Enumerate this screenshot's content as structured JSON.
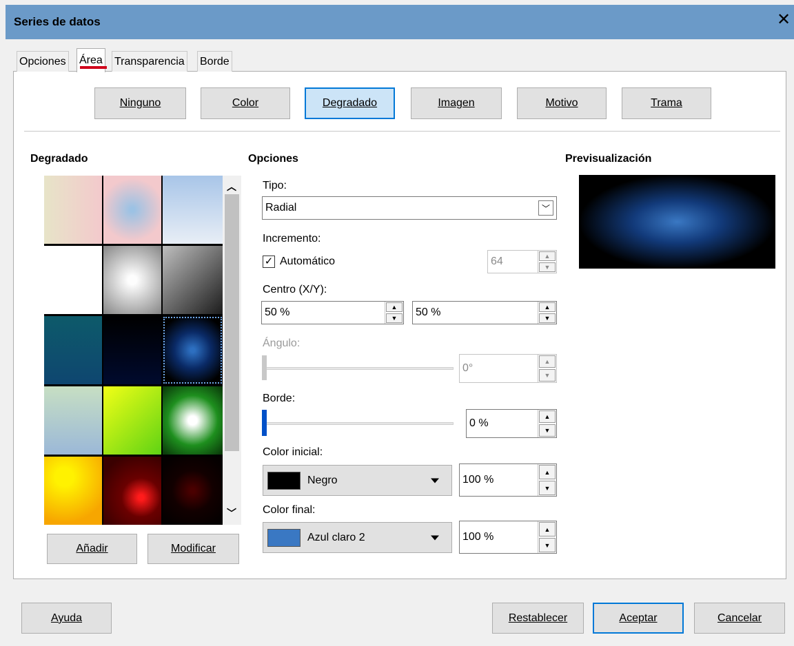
{
  "window": {
    "title": "Series de datos"
  },
  "tabs": [
    "Opciones",
    "Área",
    "Transparencia",
    "Borde"
  ],
  "area_buttons": [
    "Ninguno",
    "Color",
    "Degradado",
    "Imagen",
    "Motivo",
    "Trama"
  ],
  "gradient_panel": {
    "heading": "Degradado",
    "add_label": "Añadir",
    "modify_label": "Modificar"
  },
  "options": {
    "heading": "Opciones",
    "tipo_label": "Tipo:",
    "tipo_value": "Radial",
    "incremento_label": "Incremento:",
    "automatico_label": "Automático",
    "automatico_checked": true,
    "incremento_value": "64",
    "centro_label": "Centro (X/Y):",
    "centro_x": "50 %",
    "centro_y": "50 %",
    "angulo_label": "Ángulo:",
    "angulo_value": "0°",
    "borde_label": "Borde:",
    "borde_value": "0 %",
    "borde_level": 0,
    "color_inicial_label": "Color inicial:",
    "color_inicial_name": "Negro",
    "color_inicial_hex": "#000000",
    "color_inicial_pct": "100 %",
    "color_final_label": "Color final:",
    "color_final_name": "Azul claro 2",
    "color_final_hex": "#3a78c3",
    "color_final_pct": "100 %"
  },
  "preview": {
    "heading": "Previsualización"
  },
  "footer": {
    "help": "Ayuda",
    "reset": "Restablecer",
    "ok": "Aceptar",
    "cancel": "Cancelar"
  },
  "colors": {
    "titlebar": "#6b9ac8",
    "accent": "#0078d7",
    "tab_underline": "#d0021b"
  }
}
